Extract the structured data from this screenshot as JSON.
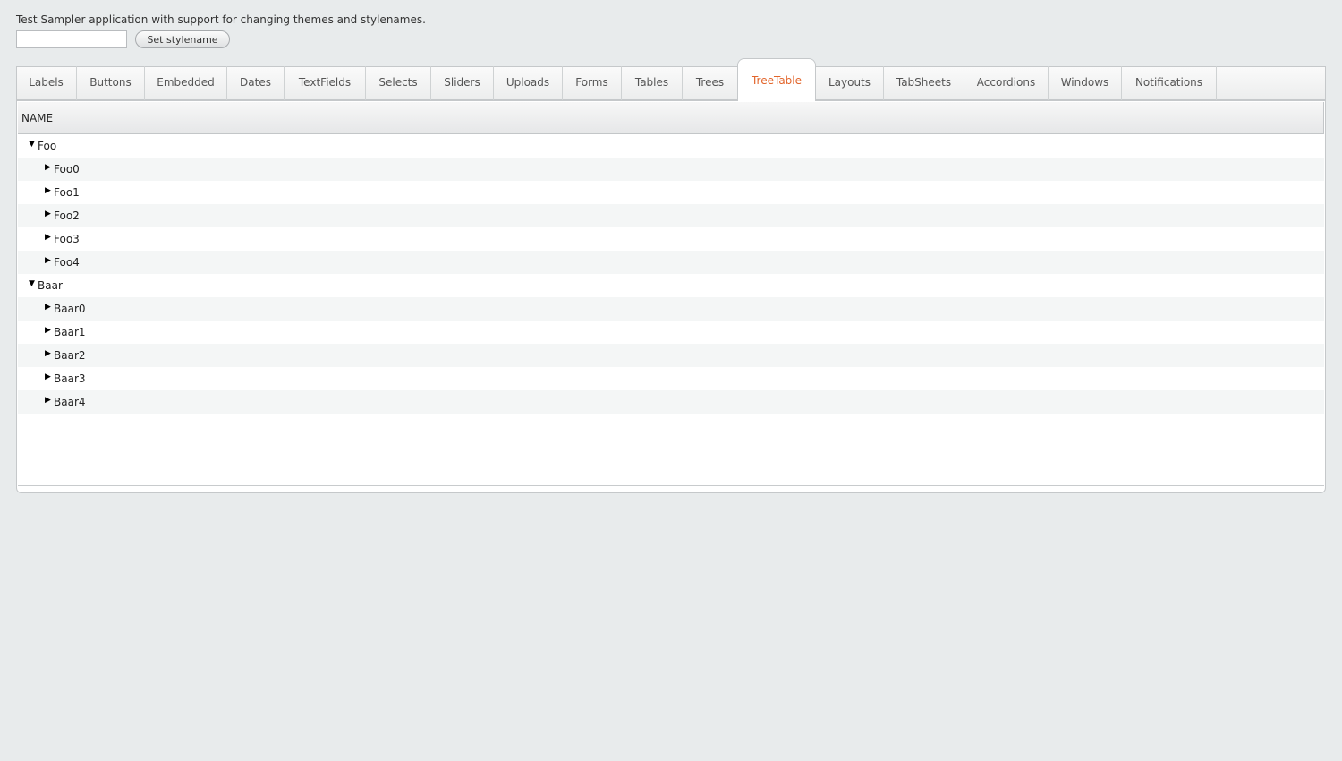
{
  "header": {
    "intro_text": "Test Sampler application with support for changing themes and stylenames.",
    "stylename_input_value": "",
    "set_stylename_label": "Set stylename"
  },
  "tabs": [
    {
      "label": "Labels"
    },
    {
      "label": "Buttons"
    },
    {
      "label": "Embedded"
    },
    {
      "label": "Dates"
    },
    {
      "label": "TextFields"
    },
    {
      "label": "Selects"
    },
    {
      "label": "Sliders"
    },
    {
      "label": "Uploads"
    },
    {
      "label": "Forms"
    },
    {
      "label": "Tables"
    },
    {
      "label": "Trees"
    },
    {
      "label": "TreeTable"
    },
    {
      "label": "Layouts"
    },
    {
      "label": "TabSheets"
    },
    {
      "label": "Accordions"
    },
    {
      "label": "Windows"
    },
    {
      "label": "Notifications"
    }
  ],
  "selected_tab": "TreeTable",
  "colors": {
    "selected_tab_text": "#e2652b",
    "background": "#e8ebec"
  },
  "treetable": {
    "column_header": "NAME",
    "rows": [
      {
        "label": "Foo",
        "level": 0,
        "expanded": true,
        "icon": "expanded-arrow-icon"
      },
      {
        "label": "Foo0",
        "level": 1,
        "expanded": false,
        "icon": "collapsed-arrow-icon"
      },
      {
        "label": "Foo1",
        "level": 1,
        "expanded": false,
        "icon": "collapsed-arrow-icon"
      },
      {
        "label": "Foo2",
        "level": 1,
        "expanded": false,
        "icon": "collapsed-arrow-icon"
      },
      {
        "label": "Foo3",
        "level": 1,
        "expanded": false,
        "icon": "collapsed-arrow-icon"
      },
      {
        "label": "Foo4",
        "level": 1,
        "expanded": false,
        "icon": "collapsed-arrow-icon"
      },
      {
        "label": "Baar",
        "level": 0,
        "expanded": true,
        "icon": "expanded-arrow-icon"
      },
      {
        "label": "Baar0",
        "level": 1,
        "expanded": false,
        "icon": "collapsed-arrow-icon"
      },
      {
        "label": "Baar1",
        "level": 1,
        "expanded": false,
        "icon": "collapsed-arrow-icon"
      },
      {
        "label": "Baar2",
        "level": 1,
        "expanded": false,
        "icon": "collapsed-arrow-icon"
      },
      {
        "label": "Baar3",
        "level": 1,
        "expanded": false,
        "icon": "collapsed-arrow-icon"
      },
      {
        "label": "Baar4",
        "level": 1,
        "expanded": false,
        "icon": "collapsed-arrow-icon"
      }
    ]
  }
}
